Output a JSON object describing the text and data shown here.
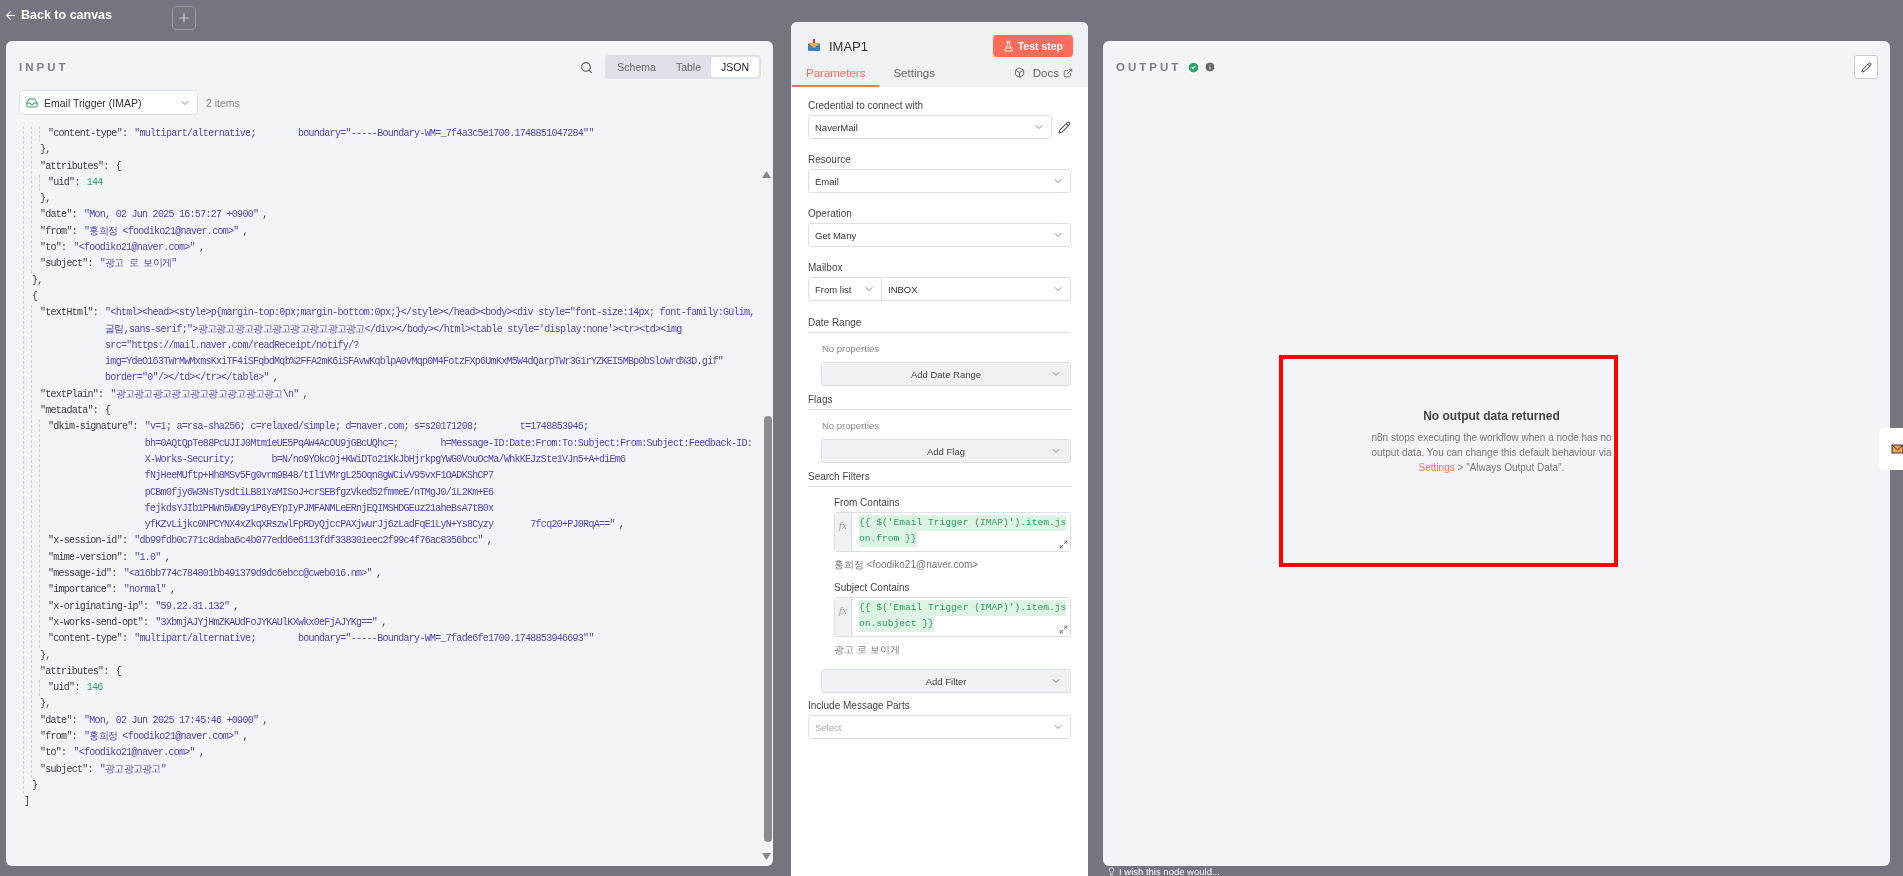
{
  "top_bar": {
    "back_link": "Back to canvas"
  },
  "input": {
    "title": "INPUT",
    "view_tabs": [
      {
        "label": "Schema",
        "selected": false
      },
      {
        "label": "Table",
        "selected": false
      },
      {
        "label": "JSON",
        "selected": true
      }
    ],
    "source": "Email Trigger (IMAP)",
    "item_count": "2 items",
    "json_tree": {
      "close": "]",
      "children": [
        {
          "close": "},",
          "children": [
            {
              "close": "},",
              "children": [
                {
                  "key": "\"content-type\":",
                  "kind": "string",
                  "value": [
                    "\"multipart/alternative;        boundary=\"-----Boundary-WM=_7f4a3c5e1700.1748851047284\"\""
                  ]
                }
              ]
            },
            {
              "key": "\"attributes\":",
              "open": "{",
              "close": "},",
              "children": [
                {
                  "key": "\"uid\":",
                  "kind": "number",
                  "value": [
                    "144"
                  ]
                }
              ]
            },
            {
              "key": "\"date\":",
              "kind": "string",
              "value": [
                "\"Mon, 02 Jun 2025 16:57:27 +0900\""
              ],
              "tail": ","
            },
            {
              "key": "\"from\":",
              "kind": "string",
              "value": [
                "\"홍희정 <foodiko21@naver.com>\""
              ],
              "tail": ","
            },
            {
              "key": "\"to\":",
              "kind": "string",
              "value": [
                "\"<foodiko21@naver.com>\""
              ],
              "tail": ","
            },
            {
              "key": "\"subject\":",
              "kind": "string",
              "value": [
                "\"광고 로 보이게\""
              ]
            }
          ]
        },
        {
          "open": "{",
          "close": "}",
          "children": [
            {
              "key": "\"textHtml\":",
              "kind": "string",
              "value": [
                "\"<html><head><style>p{margin-top:0px;margin-bottom:0px;}</style></head><body><div style=\"font-size:14px; font-family:Gulim,",
                "굴림,sans-serif;\">광고광고광고광고광고광고광고광고광고</div></body></html><table style='display:none'><tr><td><img",
                "src=\"https://mail.naver.com/readReceipt/notify/?",
                "img=YdeO163TWrMwMxmsKxiTF4iSFqbdMqb%2FFA2mK6iSFAvwKqblpA0vMqp0M4FotzFXp6UmKxM5W4dQarpTWr3G1rYZKEI5MBp0bSloWrd%3D.gif\"",
                "border=\"0\"/></td></tr></table>\""
              ],
              "tail": ","
            },
            {
              "key": "\"textPlain\":",
              "kind": "string",
              "value": [
                "\"광고광고광고광고광고광고광고광고광고\\n\""
              ],
              "tail": ","
            },
            {
              "key": "\"metadata\":",
              "open": "{",
              "close": "},",
              "children": [
                {
                  "key": "\"dkim-signature\":",
                  "kind": "string",
                  "value": [
                    "\"v=1; a=rsa-sha256; c=relaxed/simple; d=naver.com; s=s20171208;        t=1748853946;",
                    "bh=0AQtQpTe88PcUJIJ0Mtm1eUE5PqAW4AcOU9jGBcUQhc=;        h=Message-ID:Date:From:To:Subject:From:Subject:Feedback-ID:",
                    "X-Works-Security;       b=N/no9YOkc0j+KWiDTo21KkJbHjrkpgYWG0VouOcMa/WhkKEJzSte1VJn5+A+diEm6",
                    "fNjHeeMUftp+Hh8MSv5Fg0vrm9B48/tIl1VMrgL25Oqn8gWCivV95vxF1OADKShCP7",
                    "pCBm0fjy6W3NsTysdtiLB81YaMISoJ+crSEBfgzVked52fmmeE/nTMgJ0/1L2Km+E6",
                    "fejkdsYJIb1PHWn5WD9y1P6yEYpIyPJMFANMLeERnjEQIMSHDGEuz21aheBsA7tB0x",
                    "yfKZvLijkc0NPCYNX4xZkqXRszwlFpRDyQjccPAXjwurJj6zLadFqE1LyN+Ys8Cyzy       7fcq20+PJ0RqA==\""
                  ],
                  "tail": ","
                },
                {
                  "key": "\"x-session-id\":",
                  "kind": "string",
                  "value": [
                    "\"db99fdb0c771c8daba6c4b077edd6e6113fdf338301eec2f99c4f76ac8356bcc\""
                  ],
                  "tail": ","
                },
                {
                  "key": "\"mime-version\":",
                  "kind": "string",
                  "value": [
                    "\"1.0\""
                  ],
                  "tail": ","
                },
                {
                  "key": "\"message-id\":",
                  "kind": "string",
                  "value": [
                    "\"<a16bb774c784801bb491379d9dc6ebcc@cweb016.nm>\""
                  ],
                  "tail": ","
                },
                {
                  "key": "\"importance\":",
                  "kind": "string",
                  "value": [
                    "\"normal\""
                  ],
                  "tail": ","
                },
                {
                  "key": "\"x-originating-ip\":",
                  "kind": "string",
                  "value": [
                    "\"59.22.31.132\""
                  ],
                  "tail": ","
                },
                {
                  "key": "\"x-works-send-opt\":",
                  "kind": "string",
                  "value": [
                    "\"3XbmjAJYjHmZKAUdFoJYKAUlKXwkx0eFjAJYKg==\""
                  ],
                  "tail": ","
                },
                {
                  "key": "\"content-type\":",
                  "kind": "string",
                  "value": [
                    "\"multipart/alternative;        boundary=\"-----Boundary-WM=_7fade6fe1700.1748853946693\"\""
                  ]
                }
              ]
            },
            {
              "key": "\"attributes\":",
              "open": "{",
              "close": "},",
              "children": [
                {
                  "key": "\"uid\":",
                  "kind": "number",
                  "value": [
                    "146"
                  ]
                }
              ]
            },
            {
              "key": "\"date\":",
              "kind": "string",
              "value": [
                "\"Mon, 02 Jun 2025 17:45:46 +0900\""
              ],
              "tail": ","
            },
            {
              "key": "\"from\":",
              "kind": "string",
              "value": [
                "\"홍희정 <foodiko21@naver.com>\""
              ],
              "tail": ","
            },
            {
              "key": "\"to\":",
              "kind": "string",
              "value": [
                "\"<foodiko21@naver.com>\""
              ],
              "tail": ","
            },
            {
              "key": "\"subject\":",
              "kind": "string",
              "value": [
                "\"광고광고광고\""
              ]
            }
          ]
        }
      ]
    }
  },
  "node": {
    "title": "IMAP1",
    "test_button": "Test step",
    "tabs": [
      {
        "label": "Parameters",
        "selected": true
      },
      {
        "label": "Settings",
        "selected": false
      }
    ],
    "docs_link": "Docs",
    "fields": [
      {
        "kind": "credential",
        "label": "Credential to connect with",
        "value": "NaverMail"
      },
      {
        "kind": "select",
        "label": "Resource",
        "value": "Email"
      },
      {
        "kind": "select",
        "label": "Operation",
        "value": "Get Many"
      },
      {
        "kind": "mailbox",
        "label": "Mailbox",
        "mode": "From list",
        "value": "INBOX"
      },
      {
        "kind": "collection",
        "label": "Date Range",
        "empty_text": "No properties",
        "button": "Add Date Range"
      },
      {
        "kind": "collection",
        "label": "Flags",
        "empty_text": "No properties",
        "button": "Add Flag"
      },
      {
        "kind": "filters",
        "label": "Search Filters",
        "button": "Add Filter",
        "filters": [
          {
            "label": "From Contains",
            "fx": "fx",
            "expression": [
              "{{ $('Email Trigger (IMAP)').item.js",
              "on.from }}"
            ],
            "preview": "홍희정 <foodiko21@naver.com>"
          },
          {
            "label": "Subject Contains",
            "fx": "fx",
            "expression": [
              "{{ $('Email Trigger (IMAP)').item.js",
              "on.subject }}"
            ],
            "preview": "광고 로 보이게"
          }
        ]
      },
      {
        "kind": "select",
        "label": "Include Message Parts",
        "placeholder": "Select"
      }
    ]
  },
  "output": {
    "title": "OUTPUT",
    "succeeded": true,
    "empty": {
      "title": "No output data returned",
      "text_before": "n8n stops executing the workflow when a node has no output data. You can change this default behaviour via ",
      "link": "Settings",
      "text_after": " > \"Always Output Data\"."
    }
  },
  "footer_hint": "I wish this node would..."
}
